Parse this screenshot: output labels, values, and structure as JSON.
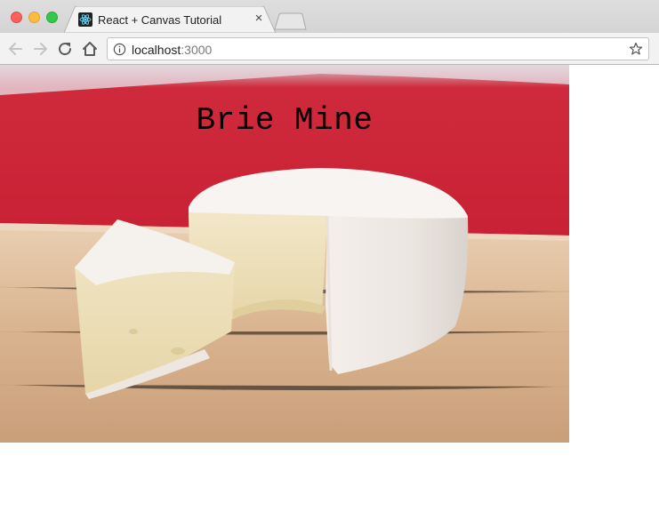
{
  "window": {
    "controls": [
      "close",
      "minimize",
      "zoom"
    ],
    "colors": {
      "close": "#fc605c",
      "minimize": "#fdbc40",
      "zoom": "#34c84a"
    }
  },
  "tab": {
    "title": "React + Canvas Tutorial",
    "favicon": "react-logo-icon",
    "close_glyph": "×"
  },
  "toolbar": {
    "back_icon": "arrow-left-icon",
    "forward_icon": "arrow-right-icon",
    "reload_icon": "reload-icon",
    "home_icon": "home-icon"
  },
  "address_bar": {
    "host": "localhost",
    "port": ":3000",
    "info_icon": "info-icon",
    "bookmark_icon": "star-icon"
  },
  "page": {
    "canvas_text": "Brie Mine",
    "canvas_image": "photo of brie cheese wheel with a cut wedge on a wooden board in front of a red background",
    "colors": {
      "text": "#000000",
      "backdrop": "#c8182c",
      "board": "#d9b38f"
    }
  }
}
